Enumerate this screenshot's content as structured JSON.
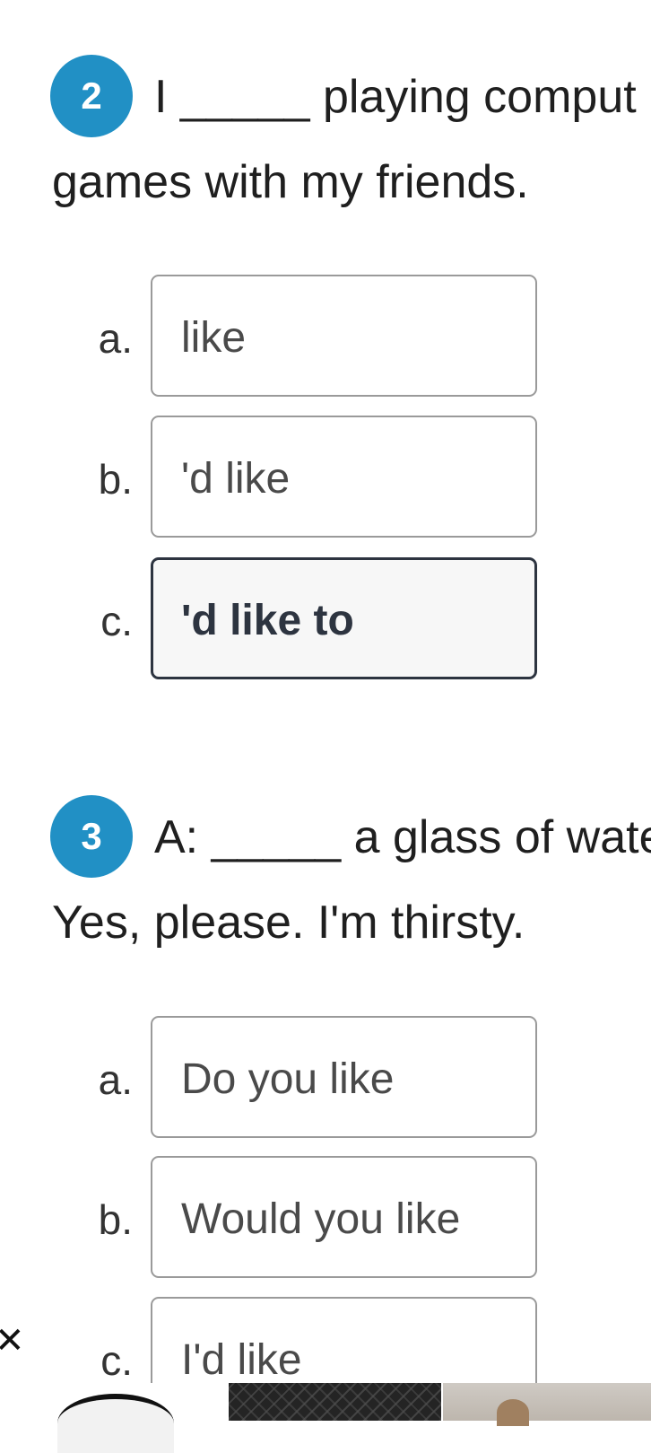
{
  "questions": [
    {
      "number": "2",
      "line1": "I _____ playing comput",
      "line2": "games with my friends.",
      "options": [
        {
          "letter": "a.",
          "text": "like",
          "selected": false
        },
        {
          "letter": "b.",
          "text": "'d like",
          "selected": false
        },
        {
          "letter": "c.",
          "text": "'d like to",
          "selected": true
        }
      ]
    },
    {
      "number": "3",
      "line1": "A: _____ a glass of wate",
      "line2": "Yes, please. I'm thirsty.",
      "options": [
        {
          "letter": "a.",
          "text": "Do you like",
          "selected": false
        },
        {
          "letter": "b.",
          "text": "Would you like",
          "selected": false
        },
        {
          "letter": "c.",
          "text": "I'd like",
          "selected": false
        }
      ]
    }
  ],
  "colors": {
    "badge": "#2190c5",
    "selected_border": "#2d3440",
    "option_border": "#9a9a9a"
  },
  "icons": {
    "close": "close-icon"
  }
}
